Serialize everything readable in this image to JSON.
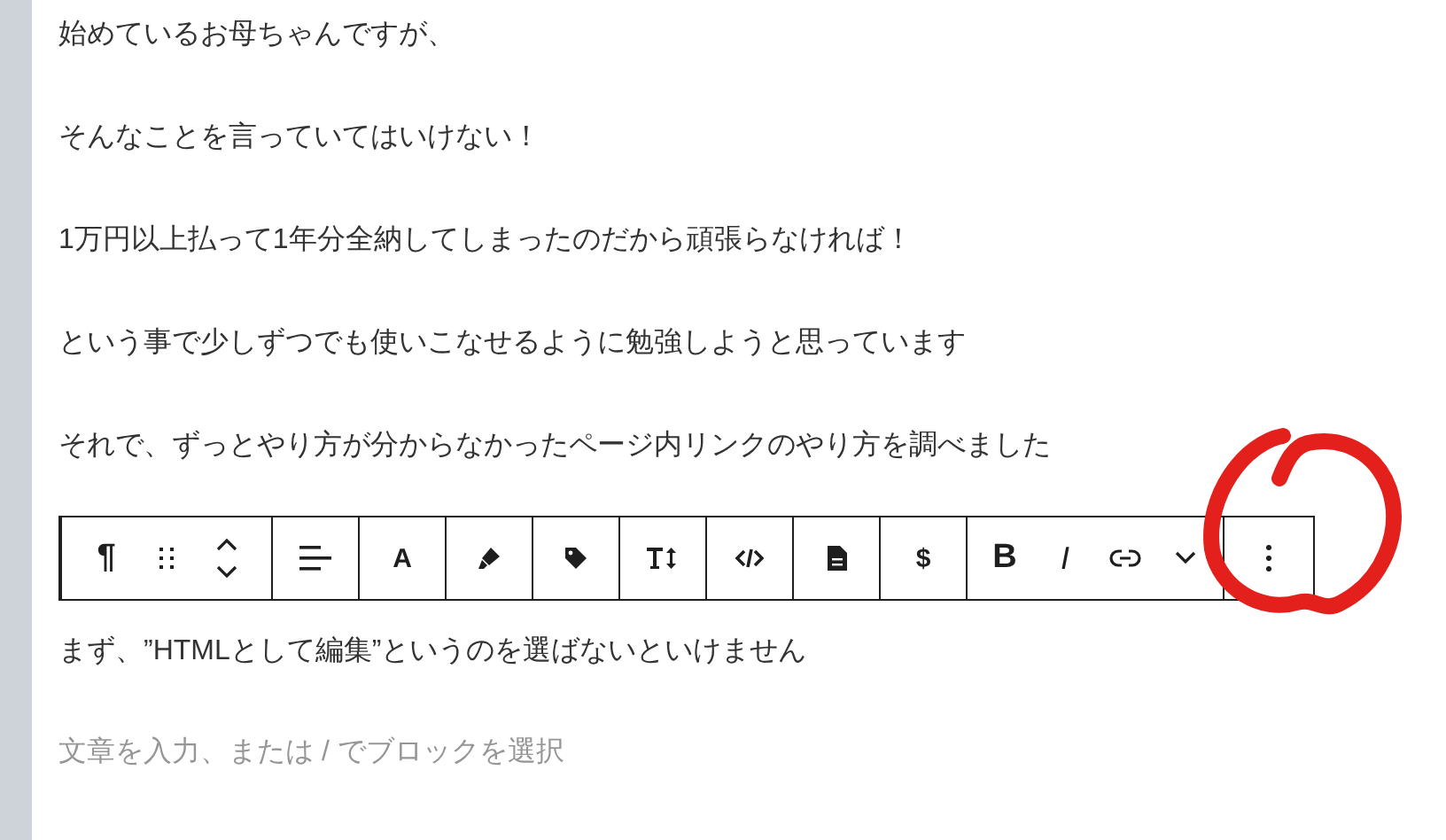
{
  "paragraphs": [
    {
      "text": "始めているお母ちゃんですが、"
    },
    {
      "text": "そんなことを言っていてはいけない！"
    },
    {
      "text": "1万円以上払って1年分全納してしまったのだから頑張らなければ！"
    },
    {
      "text": "という事で少しずつでも使いこなせるように勉強しようと思っています"
    },
    {
      "text": "それで、ずっとやり方が分からなかったページ内リンクのやり方を調べました"
    }
  ],
  "toolbar": {
    "groups": [
      {
        "items": [
          {
            "kind": "glyph",
            "label": "¶"
          },
          {
            "kind": "icon"
          },
          {
            "kind": "icon"
          }
        ]
      },
      {
        "items": [
          {
            "kind": "icon"
          }
        ]
      },
      {
        "items": [
          {
            "kind": "glyph",
            "label": "A"
          }
        ]
      },
      {
        "items": [
          {
            "kind": "icon"
          }
        ]
      },
      {
        "items": [
          {
            "kind": "icon"
          }
        ]
      },
      {
        "items": [
          {
            "kind": "icon"
          }
        ]
      },
      {
        "items": [
          {
            "kind": "icon"
          }
        ]
      },
      {
        "items": [
          {
            "kind": "icon"
          }
        ]
      },
      {
        "items": [
          {
            "kind": "glyph",
            "label": "$"
          }
        ]
      },
      {
        "items": [
          {
            "kind": "glyph",
            "label": "B"
          },
          {
            "kind": "glyph",
            "label": "I"
          },
          {
            "kind": "icon"
          },
          {
            "kind": "icon"
          }
        ]
      },
      {
        "items": [
          {
            "kind": "icon"
          }
        ]
      }
    ]
  },
  "current_paragraph": {
    "text": "まず、”HTMLとして編集”というのを選ばないといけません"
  },
  "new_block": {
    "placeholder": "文章を入力、または / でブロックを選択"
  },
  "annotation": {
    "kind": "circle"
  }
}
